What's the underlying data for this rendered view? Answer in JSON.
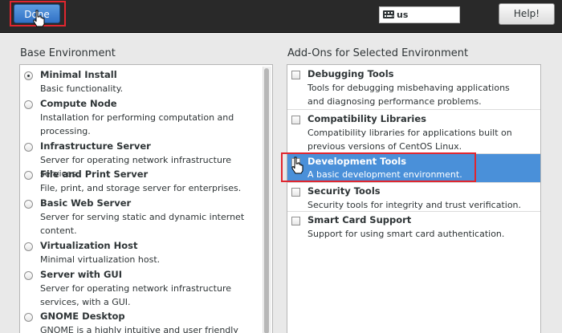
{
  "header": {
    "done_label": "Done",
    "keyboard_layout": "us",
    "help_label": "Help!"
  },
  "base_environment": {
    "title": "Base Environment",
    "selected": "Minimal Install",
    "items": [
      {
        "name": "Minimal Install",
        "desc": "Basic functionality."
      },
      {
        "name": "Compute Node",
        "desc": "Installation for performing computation and processing."
      },
      {
        "name": "Infrastructure Server",
        "desc": "Server for operating network infrastructure services."
      },
      {
        "name": "File and Print Server",
        "desc": "File, print, and storage server for enterprises."
      },
      {
        "name": "Basic Web Server",
        "desc": "Server for serving static and dynamic internet content."
      },
      {
        "name": "Virtualization Host",
        "desc": "Minimal virtualization host."
      },
      {
        "name": "Server with GUI",
        "desc": "Server for operating network infrastructure services, with a GUI."
      },
      {
        "name": "GNOME Desktop",
        "desc": "GNOME is a highly intuitive and user friendly"
      }
    ]
  },
  "addons": {
    "title": "Add-Ons for Selected Environment",
    "items": [
      {
        "name": "Debugging Tools",
        "desc": "Tools for debugging misbehaving applications and diagnosing performance problems.",
        "checked": false
      },
      {
        "name": "Compatibility Libraries",
        "desc": "Compatibility libraries for applications built on previous versions of CentOS Linux.",
        "checked": false
      },
      {
        "name": "Development Tools",
        "desc": "A basic development environment.",
        "checked": false,
        "highlighted": true
      },
      {
        "name": "Security Tools",
        "desc": "Security tools for integrity and trust verification.",
        "checked": false
      },
      {
        "name": "Smart Card Support",
        "desc": "Support for using smart card authentication.",
        "checked": false
      }
    ]
  },
  "colors": {
    "accent": "#4a90d9",
    "header_bg": "#292929",
    "highlight_box": "#e0262f"
  }
}
